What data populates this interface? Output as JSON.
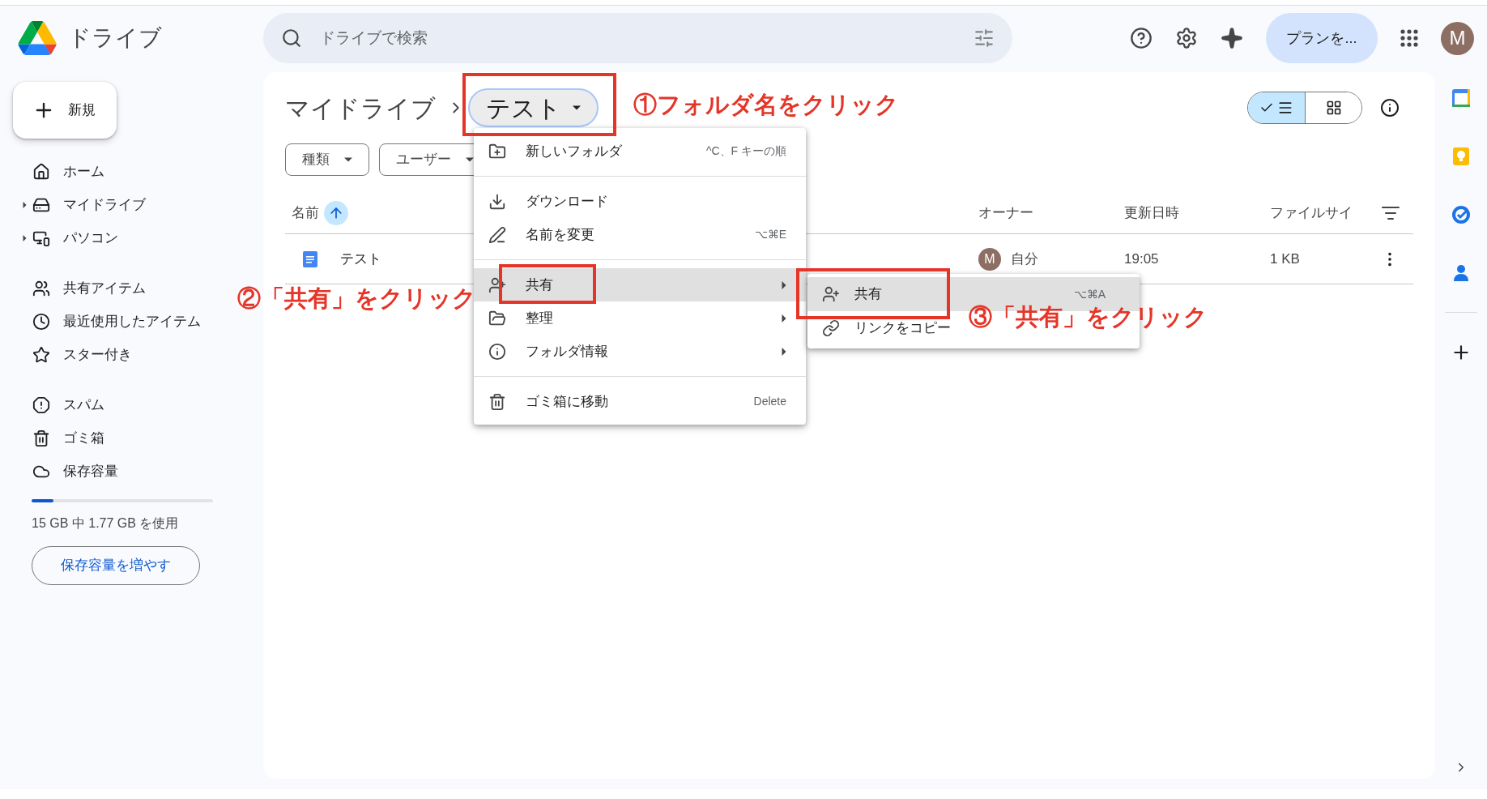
{
  "app": {
    "name": "ドライブ"
  },
  "search": {
    "placeholder": "ドライブで検索"
  },
  "header": {
    "plan_button": "プランを...",
    "avatar": "M"
  },
  "sidebar": {
    "new_button": "新規",
    "sections": [
      [
        {
          "label": "ホーム",
          "selected": false,
          "expandable": false
        },
        {
          "label": "マイドライブ",
          "selected": false,
          "expandable": true
        },
        {
          "label": "パソコン",
          "selected": false,
          "expandable": true
        }
      ],
      [
        {
          "label": "共有アイテム",
          "selected": false,
          "expandable": false
        },
        {
          "label": "最近使用したアイテム",
          "selected": false,
          "expandable": false
        },
        {
          "label": "スター付き",
          "selected": false,
          "expandable": false
        }
      ],
      [
        {
          "label": "スパム",
          "selected": false,
          "expandable": false
        },
        {
          "label": "ゴミ箱",
          "selected": false,
          "expandable": false
        },
        {
          "label": "保存容量",
          "selected": false,
          "expandable": false
        }
      ]
    ]
  },
  "storage": {
    "level": 0.12,
    "text": "15 GB 中 1.77 GB を使用",
    "button": "保存容量を増やす"
  },
  "breadcrumb": {
    "root": "マイドライブ",
    "current": "テスト"
  },
  "view_toggle": [
    {
      "kind": "list",
      "selected": true
    },
    {
      "kind": "grid",
      "selected": false
    }
  ],
  "filters": [
    "種類",
    "ユーザー"
  ],
  "table": {
    "columns": [
      {
        "label": "名前",
        "sorted": true
      },
      {
        "label": "オーナー",
        "sorted": false
      },
      {
        "label": "更新日時",
        "sorted": false
      },
      {
        "label": "ファイルサイ",
        "sorted": false
      }
    ],
    "rows": [
      {
        "name": "テスト",
        "owner_avatar": "M",
        "owner": "自分",
        "modified": "19:05",
        "size": "1 KB"
      }
    ]
  },
  "context_menu": [
    [
      {
        "label": "新しいフォルダ",
        "shortcut": "^C、F キーの順",
        "submenu": false,
        "highlighted": false
      }
    ],
    [
      {
        "label": "ダウンロード",
        "submenu": false,
        "highlighted": false
      },
      {
        "label": "名前を変更",
        "shortcut": "⌥⌘E",
        "submenu": false,
        "highlighted": false
      }
    ],
    [
      {
        "label": "共有",
        "submenu": true,
        "highlighted": true
      },
      {
        "label": "整理",
        "submenu": true,
        "highlighted": false
      },
      {
        "label": "フォルダ情報",
        "submenu": true,
        "highlighted": false
      }
    ],
    [
      {
        "label": "ゴミ箱に移動",
        "shortcut": "Delete",
        "submenu": false,
        "highlighted": false
      }
    ]
  ],
  "submenu": [
    {
      "label": "共有",
      "shortcut": "⌥⌘A",
      "highlighted": true
    },
    {
      "label": "リンクをコピー",
      "highlighted": false
    }
  ],
  "annotations": [
    {
      "text": "①フォルダ名をクリック"
    },
    {
      "text": "②「共有」をクリック"
    },
    {
      "text": "③「共有」をクリック"
    }
  ]
}
